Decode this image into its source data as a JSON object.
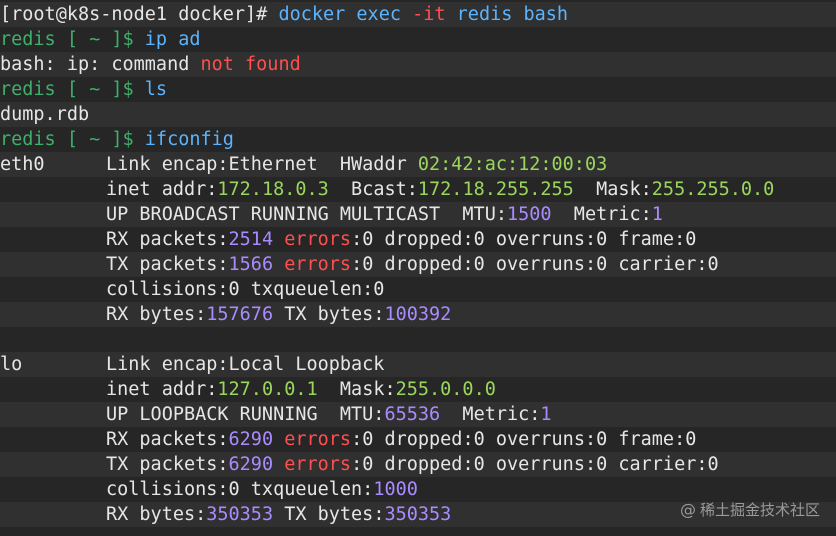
{
  "colors": {
    "default": "#e6e6e6",
    "cmd": "#5ab4ff",
    "prompt": "#3fb06a",
    "green": "#9bd65c",
    "purple": "#a98bff",
    "red": "#ff4f4f",
    "watermark": "#9a9a9a"
  },
  "terminal": {
    "lines": [
      {
        "hl": true,
        "segs": [
          {
            "t": "[root@k8s-node1 docker]# ",
            "c": "default"
          },
          {
            "t": "docker exec ",
            "c": "cmd"
          },
          {
            "t": "-it",
            "c": "red"
          },
          {
            "t": " redis bash",
            "c": "cmd"
          }
        ]
      },
      {
        "hl": false,
        "segs": [
          {
            "t": "redis [ ~ ]$ ",
            "c": "prompt"
          },
          {
            "t": "ip ad",
            "c": "cmd"
          }
        ]
      },
      {
        "hl": true,
        "segs": [
          {
            "t": "bash: ip: command ",
            "c": "default"
          },
          {
            "t": "not found",
            "c": "red"
          }
        ]
      },
      {
        "hl": false,
        "segs": [
          {
            "t": "redis [ ~ ]$ ",
            "c": "prompt"
          },
          {
            "t": "ls",
            "c": "cmd"
          }
        ]
      },
      {
        "hl": true,
        "segs": [
          {
            "t": "dump.rdb",
            "c": "default"
          }
        ]
      },
      {
        "hl": false,
        "segs": [
          {
            "t": "redis [ ~ ]$ ",
            "c": "prompt"
          },
          {
            "t": "ifconfig",
            "c": "cmd"
          }
        ]
      },
      {
        "hl": true,
        "label": "eth0",
        "segs": [
          {
            "t": "Link encap:Ethernet  HWaddr ",
            "c": "default"
          },
          {
            "t": "02:42:ac:12:00:03",
            "c": "green"
          }
        ]
      },
      {
        "hl": false,
        "segs": [
          {
            "t": "inet addr:",
            "c": "default"
          },
          {
            "t": "172.18.0.3",
            "c": "green"
          },
          {
            "t": "  Bcast:",
            "c": "default"
          },
          {
            "t": "172.18.255.255",
            "c": "green"
          },
          {
            "t": "  Mask:",
            "c": "default"
          },
          {
            "t": "255.255.0.0",
            "c": "green"
          }
        ]
      },
      {
        "hl": true,
        "segs": [
          {
            "t": "UP BROADCAST RUNNING MULTICAST  MTU:",
            "c": "default"
          },
          {
            "t": "1500",
            "c": "purple"
          },
          {
            "t": "  Metric:",
            "c": "default"
          },
          {
            "t": "1",
            "c": "purple"
          }
        ]
      },
      {
        "hl": false,
        "segs": [
          {
            "t": "RX packets:",
            "c": "default"
          },
          {
            "t": "2514",
            "c": "purple"
          },
          {
            "t": " errors",
            "c": "red"
          },
          {
            "t": ":0 dropped:0 overruns:0 frame:0",
            "c": "default"
          }
        ]
      },
      {
        "hl": true,
        "segs": [
          {
            "t": "TX packets:",
            "c": "default"
          },
          {
            "t": "1566",
            "c": "purple"
          },
          {
            "t": " errors",
            "c": "red"
          },
          {
            "t": ":0 dropped:0 overruns:0 carrier:0",
            "c": "default"
          }
        ]
      },
      {
        "hl": false,
        "segs": [
          {
            "t": "collisions:0 txqueuelen:0",
            "c": "default"
          }
        ]
      },
      {
        "hl": true,
        "segs": [
          {
            "t": "RX bytes:",
            "c": "default"
          },
          {
            "t": "157676",
            "c": "purple"
          },
          {
            "t": " TX bytes:",
            "c": "default"
          },
          {
            "t": "100392",
            "c": "purple"
          }
        ]
      },
      {
        "hl": false,
        "segs": []
      },
      {
        "hl": true,
        "label": "lo",
        "segs": [
          {
            "t": "Link encap:Local Loopback",
            "c": "default"
          }
        ]
      },
      {
        "hl": false,
        "segs": [
          {
            "t": "inet addr:",
            "c": "default"
          },
          {
            "t": "127.0.0.1",
            "c": "green"
          },
          {
            "t": "  Mask:",
            "c": "default"
          },
          {
            "t": "255.0.0.0",
            "c": "green"
          }
        ]
      },
      {
        "hl": true,
        "segs": [
          {
            "t": "UP LOOPBACK RUNNING  MTU:",
            "c": "default"
          },
          {
            "t": "65536",
            "c": "purple"
          },
          {
            "t": "  Metric:",
            "c": "default"
          },
          {
            "t": "1",
            "c": "purple"
          }
        ]
      },
      {
        "hl": false,
        "segs": [
          {
            "t": "RX packets:",
            "c": "default"
          },
          {
            "t": "6290",
            "c": "purple"
          },
          {
            "t": " errors",
            "c": "red"
          },
          {
            "t": ":0 dropped:0 overruns:0 frame:0",
            "c": "default"
          }
        ]
      },
      {
        "hl": true,
        "segs": [
          {
            "t": "TX packets:",
            "c": "default"
          },
          {
            "t": "6290",
            "c": "purple"
          },
          {
            "t": " errors",
            "c": "red"
          },
          {
            "t": ":0 dropped:0 overruns:0 carrier:0",
            "c": "default"
          }
        ]
      },
      {
        "hl": false,
        "segs": [
          {
            "t": "collisions:0 txqueuelen:",
            "c": "default"
          },
          {
            "t": "1000",
            "c": "purple"
          }
        ]
      },
      {
        "hl": true,
        "segs": [
          {
            "t": "RX bytes:",
            "c": "default"
          },
          {
            "t": "350353",
            "c": "purple"
          },
          {
            "t": " TX bytes:",
            "c": "default"
          },
          {
            "t": "350353",
            "c": "purple"
          }
        ]
      }
    ]
  },
  "watermark": {
    "at": "@",
    "text": "稀土掘金技术社区"
  }
}
